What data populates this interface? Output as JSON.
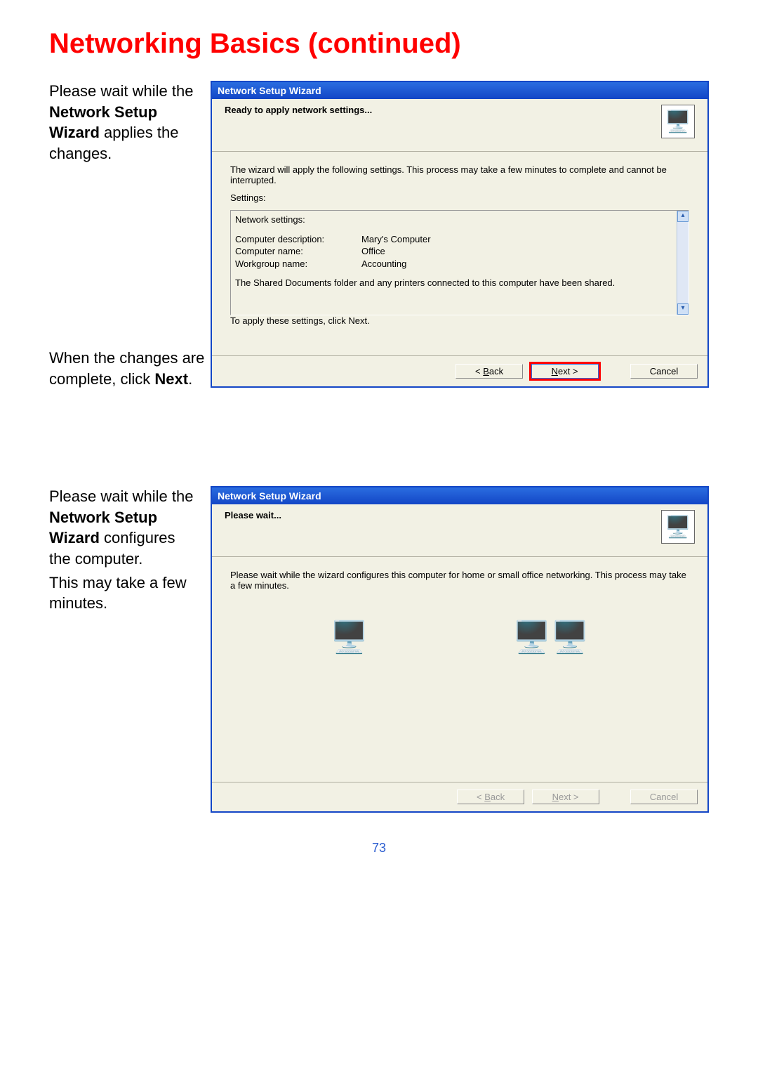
{
  "page": {
    "title": "Networking Basics (continued)",
    "number": "73"
  },
  "section1": {
    "side_pre": "Please wait while the ",
    "side_bold": "Network Setup Wizard",
    "side_post": " applies the changes.",
    "side2_pre": "When the changes are complete, click ",
    "side2_bold": "Next",
    "side2_post": "."
  },
  "wizard1": {
    "title": "Network Setup Wizard",
    "header": "Ready to apply network settings...",
    "intro": "The wizard will apply the following settings. This process may take a few minutes to complete and cannot be interrupted.",
    "settings_label": "Settings:",
    "settings_header": "Network settings:",
    "kv": [
      {
        "k": "Computer description:",
        "v": "Mary's Computer"
      },
      {
        "k": "Computer name:",
        "v": "Office"
      },
      {
        "k": "Workgroup name:",
        "v": "Accounting"
      }
    ],
    "shared_line": "The Shared Documents folder and any printers connected to this computer have been shared.",
    "instr": "To apply these settings, click Next.",
    "back_pre": "< ",
    "back_ul": "B",
    "back_post": "ack",
    "next_ul": "N",
    "next_post": "ext >",
    "cancel": "Cancel"
  },
  "section2": {
    "side_pre": "Please wait while the ",
    "side_bold": "Network Setup Wizard",
    "side_post": " configures the computer.",
    "side_extra": "This may take a few minutes."
  },
  "wizard2": {
    "title": "Network Setup Wizard",
    "header": "Please wait...",
    "intro": "Please wait while the wizard configures this computer for home or small office networking. This process may take a few minutes.",
    "back_pre": "< ",
    "back_ul": "B",
    "back_post": "ack",
    "next_ul": "N",
    "next_post": "ext >",
    "cancel": "Cancel"
  }
}
